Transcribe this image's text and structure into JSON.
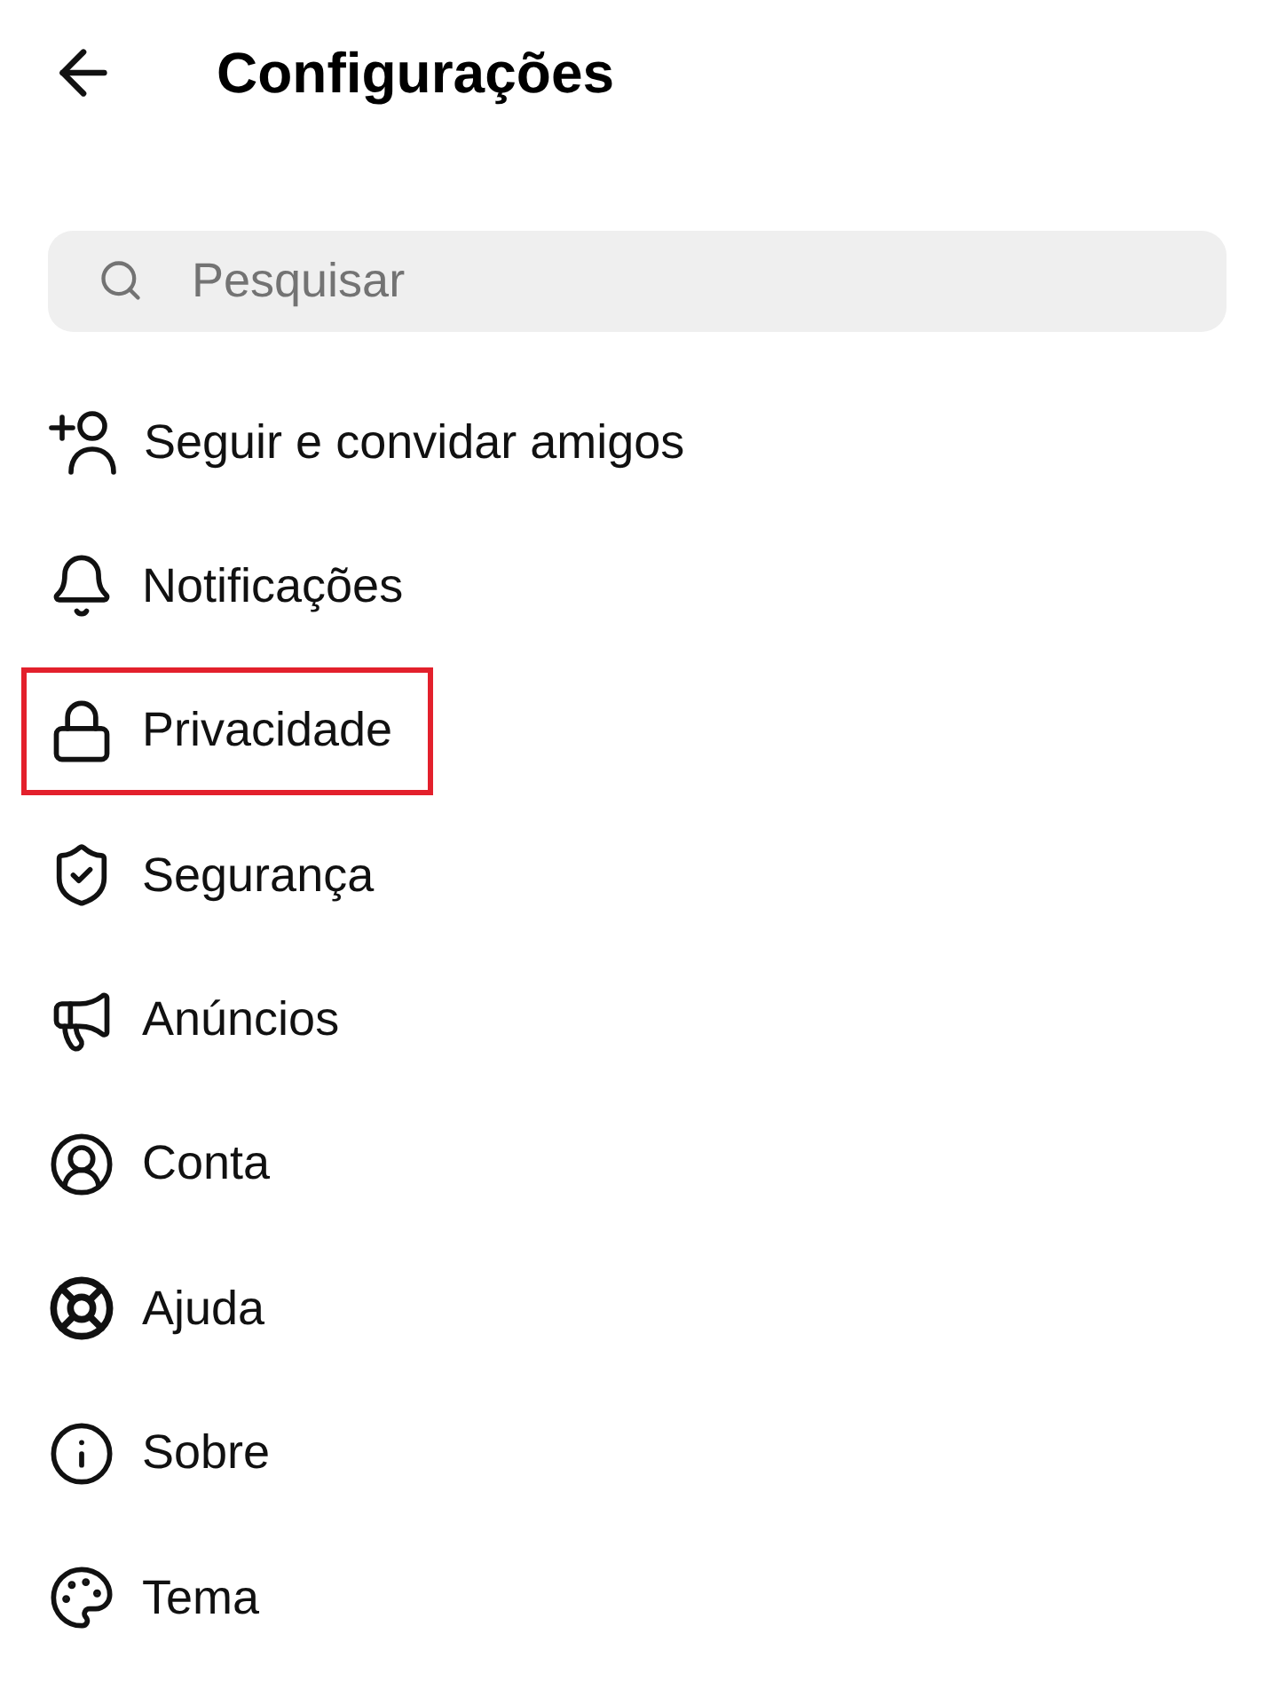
{
  "header": {
    "title": "Configurações"
  },
  "search": {
    "placeholder": "Pesquisar"
  },
  "items": [
    {
      "kind": "invite",
      "label": "Seguir e convidar amigos",
      "highlighted": false
    },
    {
      "kind": "bell",
      "label": "Notificações",
      "highlighted": false
    },
    {
      "kind": "lock",
      "label": "Privacidade",
      "highlighted": true
    },
    {
      "kind": "shield",
      "label": "Segurança",
      "highlighted": false
    },
    {
      "kind": "megaphone",
      "label": "Anúncios",
      "highlighted": false
    },
    {
      "kind": "account",
      "label": "Conta",
      "highlighted": false
    },
    {
      "kind": "help",
      "label": "Ajuda",
      "highlighted": false
    },
    {
      "kind": "info",
      "label": "Sobre",
      "highlighted": false
    },
    {
      "kind": "palette",
      "label": "Tema",
      "highlighted": false
    }
  ]
}
